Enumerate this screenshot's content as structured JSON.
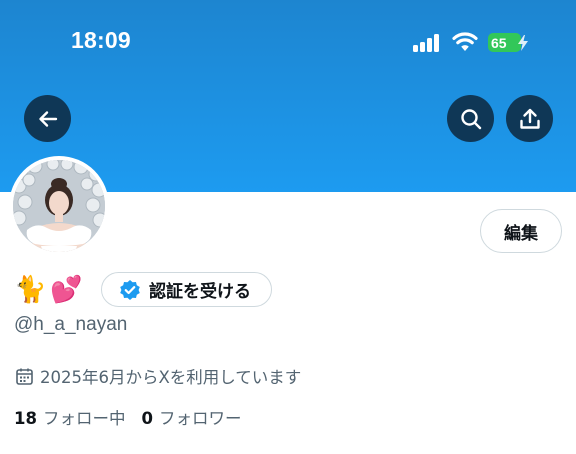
{
  "status_bar": {
    "time": "18:09",
    "battery_level": "65"
  },
  "header": {
    "back_icon": "arrow-left-icon",
    "search_icon": "search-icon",
    "share_icon": "upload-icon",
    "banner_color": "#1d9bf0",
    "button_color": "#0f3756"
  },
  "profile": {
    "display_name_emojis": "🐈💕",
    "verify_label": "認証を受ける",
    "handle": "@h_a_nayan",
    "joined": "2025年6月からXを利用しています",
    "edit_label": "編集",
    "following_count": "18",
    "following_label": "フォロー中",
    "followers_count": "0",
    "followers_label": "フォロワー"
  },
  "colors": {
    "verified_badge": "#1d9bf0",
    "secondary_text": "#536471",
    "primary_text": "#0f1419"
  }
}
